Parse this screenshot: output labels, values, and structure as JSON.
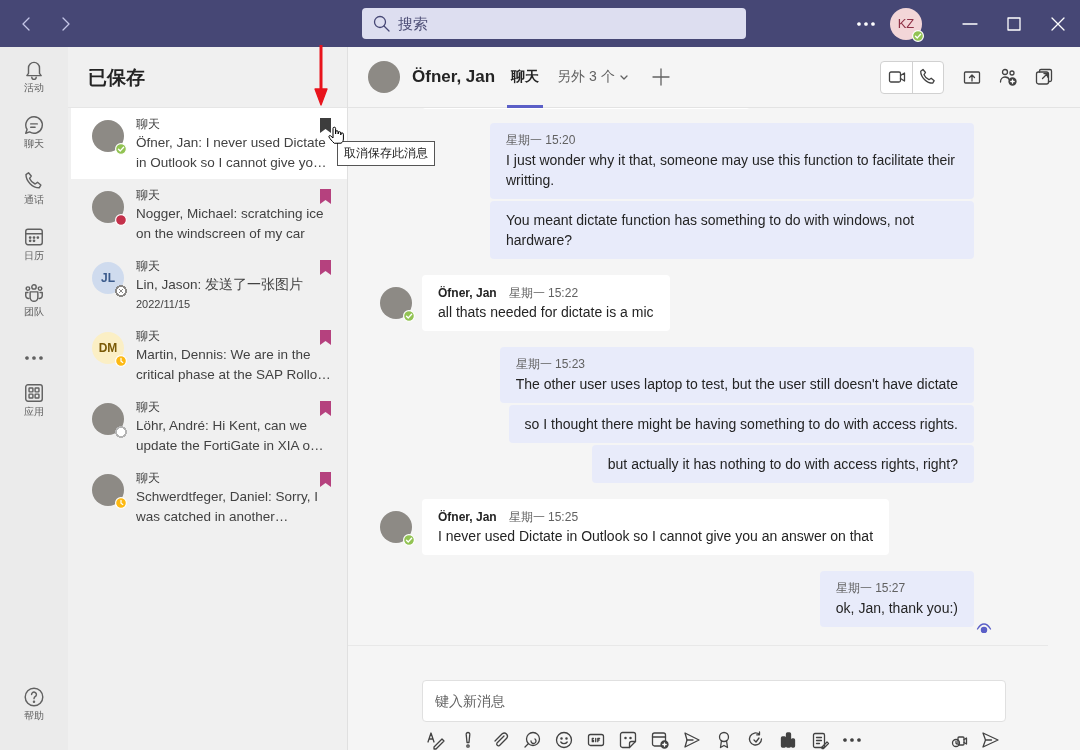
{
  "titlebar": {
    "search": {
      "placeholder": "搜索"
    },
    "user": {
      "initials": "KZ",
      "presence": {
        "kind": "available",
        "color": "#92c353"
      }
    }
  },
  "rail": {
    "items": [
      {
        "kind": "nav",
        "label": "活动"
      },
      {
        "kind": "nav",
        "label": "聊天"
      },
      {
        "kind": "nav",
        "label": "通话"
      },
      {
        "kind": "nav",
        "label": "日历"
      },
      {
        "kind": "nav",
        "label": "团队"
      },
      {
        "kind": "more"
      },
      {
        "kind": "nav",
        "label": "应用"
      }
    ],
    "help": {
      "label": "帮助"
    }
  },
  "saved": {
    "title": "已保存",
    "tooltip": "取消保存此消息",
    "items": [
      {
        "category": "聊天",
        "preview": "Öfner, Jan: I never used Dictate in Outlook so I cannot give yo…",
        "avatar": {
          "kind": "photo"
        },
        "presence": {
          "kind": "available",
          "color": "#92c353"
        },
        "selected": true,
        "hovered": true
      },
      {
        "category": "聊天",
        "preview": "Nogger, Michael: scratching ice on the windscreen of my car",
        "avatar": {
          "kind": "photo"
        },
        "presence": {
          "kind": "busy",
          "color": "#c4314b"
        },
        "selected": false,
        "hovered": false
      },
      {
        "category": "聊天",
        "preview": "Lin, Jason: 发送了一张图片",
        "date": "2022/11/15",
        "avatar": {
          "kind": "initials",
          "initials": "JL",
          "color": "#cfdbee"
        },
        "presence": {
          "kind": "offline",
          "color": "#8a8886"
        },
        "selected": false,
        "hovered": false
      },
      {
        "category": "聊天",
        "preview": "Martin, Dennis: We are in the critical phase at the SAP Rollo…",
        "avatar": {
          "kind": "initials",
          "initials": "DM",
          "color": "#fbefc5"
        },
        "presence": {
          "kind": "away",
          "color": "#fdb913"
        },
        "selected": false,
        "hovered": false
      },
      {
        "category": "聊天",
        "preview": "Löhr, André: Hi Kent, can we update the FortiGate in XIA o…",
        "avatar": {
          "kind": "photo"
        },
        "presence": {
          "kind": "unknown",
          "color": "#b3b3b3"
        },
        "selected": false,
        "hovered": false
      },
      {
        "category": "聊天",
        "preview": "Schwerdtfeger, Daniel: Sorry, I was catched in another…",
        "avatar": {
          "kind": "photo"
        },
        "presence": {
          "kind": "away",
          "color": "#fdb913"
        },
        "selected": false,
        "hovered": false
      }
    ]
  },
  "chat": {
    "contact": {
      "name": "Öfner, Jan"
    },
    "tabs": [
      {
        "label": "聊天",
        "selected": true,
        "dropdown": false
      },
      {
        "label": "另外 3 个",
        "selected": false,
        "dropdown": true
      }
    ],
    "messages": [
      {
        "kind": "sent",
        "time": "星期一 15:20",
        "bubbles": [
          "I just wonder why it that, someone may use this function to facilitate their writting.",
          "You meant dictate function has something to do with windows, not hardware?"
        ]
      },
      {
        "kind": "received",
        "author": "Öfner, Jan",
        "time": "星期一 15:22",
        "presence": {
          "kind": "available",
          "color": "#92c353"
        },
        "bubbles": [
          "all thats needed for dictate is a mic"
        ]
      },
      {
        "kind": "sent",
        "time": "星期一 15:23",
        "bubbles": [
          "The other user uses laptop to test, but the user still doesn't have dictate",
          "so I thought there might be having something to do with access rights.",
          "but actually it has nothing to do with access rights, right?"
        ]
      },
      {
        "kind": "received",
        "author": "Öfner, Jan",
        "time": "星期一 15:25",
        "presence": {
          "kind": "available",
          "color": "#92c353"
        },
        "bubbles": [
          "I never used Dictate in Outlook so I cannot give you an answer on that"
        ]
      },
      {
        "kind": "sent",
        "time": "星期一 15:27",
        "seen": true,
        "bubbles": [
          "ok, Jan, thank you:)"
        ]
      }
    ],
    "composer": {
      "placeholder": "键入新消息"
    }
  }
}
